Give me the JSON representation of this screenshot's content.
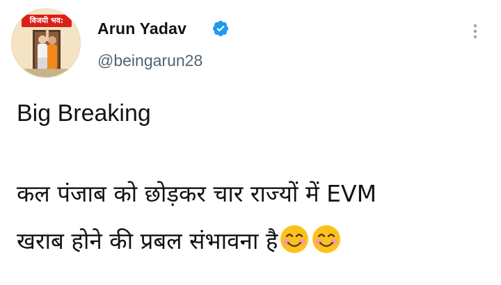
{
  "profile": {
    "avatar_banner_text": "विजयी भव:",
    "display_name": "Arun Yadav",
    "handle": "@beingarun28",
    "verified": true,
    "verified_icon": "verified-badge-icon",
    "verified_color": "#1d9bf0"
  },
  "tweet": {
    "line_1": "Big Breaking",
    "line_2": "कल पंजाब को छोड़कर चार राज्यों में EVM",
    "line_3": "खराब होने की प्रबल संभावना है",
    "emojis": [
      "smiling-face-with-smiling-eyes-icon",
      "smiling-face-with-smiling-eyes-icon"
    ]
  },
  "menu": {
    "icon": "more-vertical-icon"
  },
  "colors": {
    "text": "#0f1419",
    "secondary_text": "#536471",
    "verified": "#1d9bf0",
    "banner": "#d9211a"
  }
}
